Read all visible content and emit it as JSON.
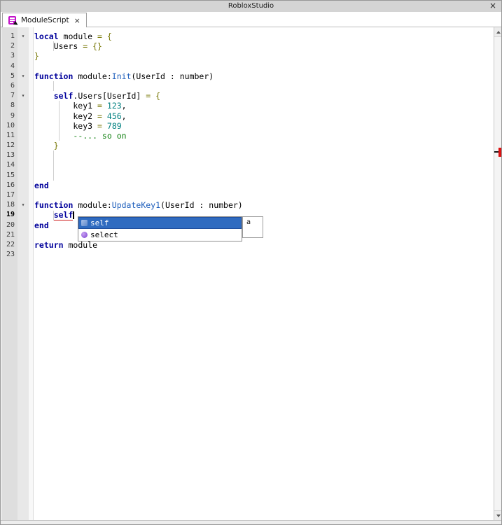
{
  "window": {
    "title": "RobloxStudio",
    "close_glyph": "×"
  },
  "tab": {
    "label": "ModuleScript",
    "close_glyph": "×",
    "icon": "module-script-icon"
  },
  "colors": {
    "keyword": "#00009b",
    "method": "#1c5dbb",
    "number": "#008080",
    "comment": "#0f7f0f",
    "operator": "#757500",
    "selection": "#2f6bc0",
    "error_underline": "#cf1d1d",
    "error_marker": "#dd1111"
  },
  "editor": {
    "fold_glyph": "▾",
    "lines": [
      {
        "n": 1,
        "fold": true,
        "tokens": [
          [
            "k",
            "local"
          ],
          [
            "p",
            " module "
          ],
          [
            "o",
            "="
          ],
          [
            "p",
            " "
          ],
          [
            "o",
            "{"
          ]
        ]
      },
      {
        "n": 2,
        "tokens": [
          [
            "p",
            "    Users "
          ],
          [
            "o",
            "="
          ],
          [
            "p",
            " "
          ],
          [
            "o",
            "{}"
          ]
        ]
      },
      {
        "n": 3,
        "tokens": [
          [
            "o",
            "}"
          ]
        ]
      },
      {
        "n": 4,
        "tokens": []
      },
      {
        "n": 5,
        "fold": true,
        "tokens": [
          [
            "k",
            "function"
          ],
          [
            "p",
            " module:"
          ],
          [
            "m",
            "Init"
          ],
          [
            "p",
            "(UserId : number)"
          ]
        ]
      },
      {
        "n": 6,
        "tokens": []
      },
      {
        "n": 7,
        "fold": true,
        "tokens": [
          [
            "p",
            "    "
          ],
          [
            "k",
            "self"
          ],
          [
            "p",
            ".Users[UserId] "
          ],
          [
            "o",
            "="
          ],
          [
            "p",
            " "
          ],
          [
            "o",
            "{"
          ]
        ]
      },
      {
        "n": 8,
        "tokens": [
          [
            "p",
            "        key1 "
          ],
          [
            "o",
            "="
          ],
          [
            "p",
            " "
          ],
          [
            "n",
            "123"
          ],
          [
            "p",
            ","
          ]
        ]
      },
      {
        "n": 9,
        "tokens": [
          [
            "p",
            "        key2 "
          ],
          [
            "o",
            "="
          ],
          [
            "p",
            " "
          ],
          [
            "n",
            "456"
          ],
          [
            "p",
            ","
          ]
        ]
      },
      {
        "n": 10,
        "tokens": [
          [
            "p",
            "        key3 "
          ],
          [
            "o",
            "="
          ],
          [
            "p",
            " "
          ],
          [
            "n",
            "789"
          ]
        ]
      },
      {
        "n": 11,
        "tokens": [
          [
            "p",
            "        "
          ],
          [
            "c",
            "--... so on"
          ]
        ]
      },
      {
        "n": 12,
        "tokens": [
          [
            "p",
            "    "
          ],
          [
            "o",
            "}"
          ]
        ]
      },
      {
        "n": 13,
        "tokens": []
      },
      {
        "n": 14,
        "tokens": []
      },
      {
        "n": 15,
        "tokens": []
      },
      {
        "n": 16,
        "tokens": [
          [
            "k",
            "end"
          ]
        ]
      },
      {
        "n": 17,
        "tokens": []
      },
      {
        "n": 18,
        "fold": true,
        "tokens": [
          [
            "k",
            "function"
          ],
          [
            "p",
            " module:"
          ],
          [
            "m",
            "UpdateKey1"
          ],
          [
            "p",
            "(UserId : number)"
          ]
        ]
      },
      {
        "n": 19,
        "current": true,
        "caret": true,
        "tokens": [
          [
            "p",
            "    "
          ],
          [
            "e",
            "self"
          ]
        ]
      },
      {
        "n": 20,
        "tokens": [
          [
            "k",
            "end"
          ]
        ]
      },
      {
        "n": 21,
        "tokens": []
      },
      {
        "n": 22,
        "tokens": [
          [
            "k",
            "return"
          ],
          [
            "p",
            " module"
          ]
        ]
      },
      {
        "n": 23,
        "tokens": []
      }
    ]
  },
  "autocomplete": {
    "items": [
      {
        "label": "self",
        "icon": "cube-icon",
        "selected": true
      },
      {
        "label": "select",
        "icon": "function-icon",
        "selected": false
      }
    ],
    "doc_text": "a"
  }
}
